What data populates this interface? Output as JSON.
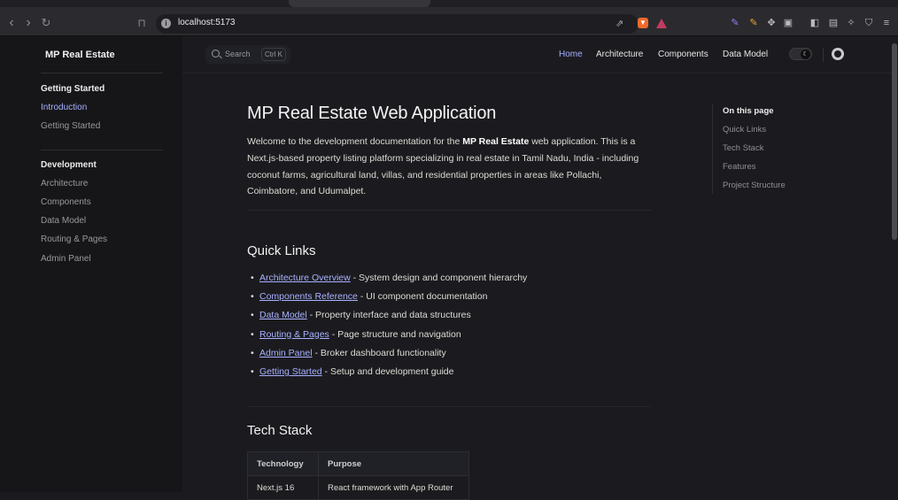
{
  "browser": {
    "url": "localhost:5173",
    "icons": [
      "back-icon",
      "forward-icon",
      "reload-icon",
      "bookmark-icon",
      "site-info-icon",
      "share-icon",
      "brave-shield-icon",
      "brave-rewards-icon",
      "extension-icons",
      "sidebar-icon",
      "wallet-icon",
      "leo-icon",
      "vpn-icon",
      "menu-icon"
    ]
  },
  "sidebar": {
    "brand": "MP Real Estate",
    "groups": [
      {
        "title": "Getting Started",
        "items": [
          {
            "label": "Introduction",
            "active": true
          },
          {
            "label": "Getting Started"
          }
        ]
      },
      {
        "title": "Development",
        "items": [
          {
            "label": "Architecture"
          },
          {
            "label": "Components"
          },
          {
            "label": "Data Model"
          },
          {
            "label": "Routing & Pages"
          },
          {
            "label": "Admin Panel"
          }
        ]
      }
    ]
  },
  "topnav": {
    "search_label": "Search",
    "search_kbd": "Ctrl K",
    "links": [
      "Home",
      "Architecture",
      "Components",
      "Data Model"
    ],
    "active_link": "Home"
  },
  "main": {
    "title": "MP Real Estate Web Application",
    "intro_before": "Welcome to the development documentation for the ",
    "intro_bold": "MP Real Estate",
    "intro_after": " web application. This is a Next.js-based property listing platform specializing in real estate in Tamil Nadu, India - including coconut farms, agricultural land, villas, and residential properties in areas like Pollachi, Coimbatore, and Udumalpet.",
    "quick_links_heading": "Quick Links",
    "quick_links": [
      {
        "link": "Architecture Overview",
        "desc": " - System design and component hierarchy"
      },
      {
        "link": "Components Reference",
        "desc": " - UI component documentation"
      },
      {
        "link": "Data Model",
        "desc": " - Property interface and data structures"
      },
      {
        "link": "Routing & Pages",
        "desc": " - Page structure and navigation"
      },
      {
        "link": "Admin Panel",
        "desc": " - Broker dashboard functionality"
      },
      {
        "link": "Getting Started",
        "desc": " - Setup and development guide"
      }
    ],
    "tech_stack_heading": "Tech Stack",
    "table": {
      "headers": [
        "Technology",
        "Purpose"
      ],
      "rows": [
        [
          "Next.js 16",
          "React framework with App Router"
        ]
      ]
    }
  },
  "on_this_page": {
    "heading": "On this page",
    "items": [
      "Quick Links",
      "Tech Stack",
      "Features",
      "Project Structure"
    ]
  },
  "colors": {
    "accent": "#a8b1ff",
    "background": "#1b1b1f",
    "sidebar_bg": "#161618"
  }
}
